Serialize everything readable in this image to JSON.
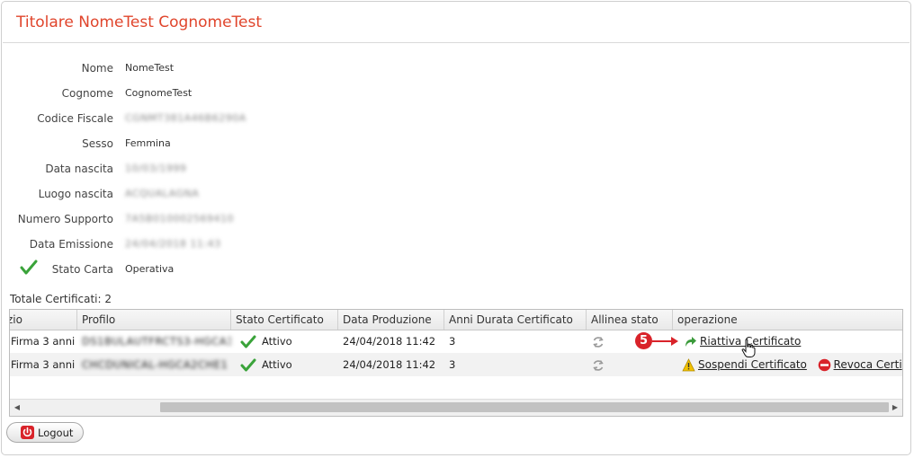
{
  "panel": {
    "title": "Titolare NomeTest CognomeTest"
  },
  "fields": [
    {
      "label": "Nome",
      "value": "NomeTest",
      "blurred": false
    },
    {
      "label": "Cognome",
      "value": "CognomeTest",
      "blurred": false
    },
    {
      "label": "Codice Fiscale",
      "value": "CGNMT381A46B6290A",
      "blurred": true
    },
    {
      "label": "Sesso",
      "value": "Femmina",
      "blurred": false
    },
    {
      "label": "Data nascita",
      "value": "10/03/1999",
      "blurred": true
    },
    {
      "label": "Luogo nascita",
      "value": "ACQUALAGNA",
      "blurred": true
    },
    {
      "label": "Numero Supporto",
      "value": "7A5B010002569410",
      "blurred": true
    },
    {
      "label": "Data Emissione",
      "value": "24/04/2018 11:43",
      "blurred": true
    },
    {
      "label": "Stato Carta",
      "value": "Operativa",
      "blurred": false,
      "icon": "check-icon"
    }
  ],
  "totale_label": "Totale Certificati: 2",
  "grid": {
    "columns": [
      "zio",
      "Profilo",
      "Stato Certificato",
      "Data Produzione",
      "Anni Durata Certificato",
      "Allinea stato",
      "operazione"
    ],
    "rows": [
      {
        "tipo": "Firma 3 anni",
        "profilo": "DS1BULAUTFRCTS3-HGCA3FD1",
        "stato": "Attivo",
        "data": "24/04/2018 11:42",
        "anni": "3",
        "ops": [
          {
            "label": "Riattiva Certificato",
            "icon": "reactivate-arrow-icon",
            "color": "#3a9a3a"
          }
        ]
      },
      {
        "tipo": "Firma 3 anni",
        "profilo": "CHCDUNICAL-HGCA2CHE1",
        "stato": "Attivo",
        "data": "24/04/2018 11:42",
        "anni": "3",
        "ops": [
          {
            "label": "Sospendi Certificato",
            "icon": "warning-icon",
            "color": "#f2c200"
          },
          {
            "label": "Revoca Certi",
            "icon": "revoke-icon",
            "color": "#d9232a"
          }
        ]
      }
    ]
  },
  "step_marker": {
    "number": "5"
  },
  "logout": {
    "label": "Logout"
  },
  "colors": {
    "title": "#e0452c",
    "check": "#3aa33a",
    "badge": "#d9232a"
  }
}
